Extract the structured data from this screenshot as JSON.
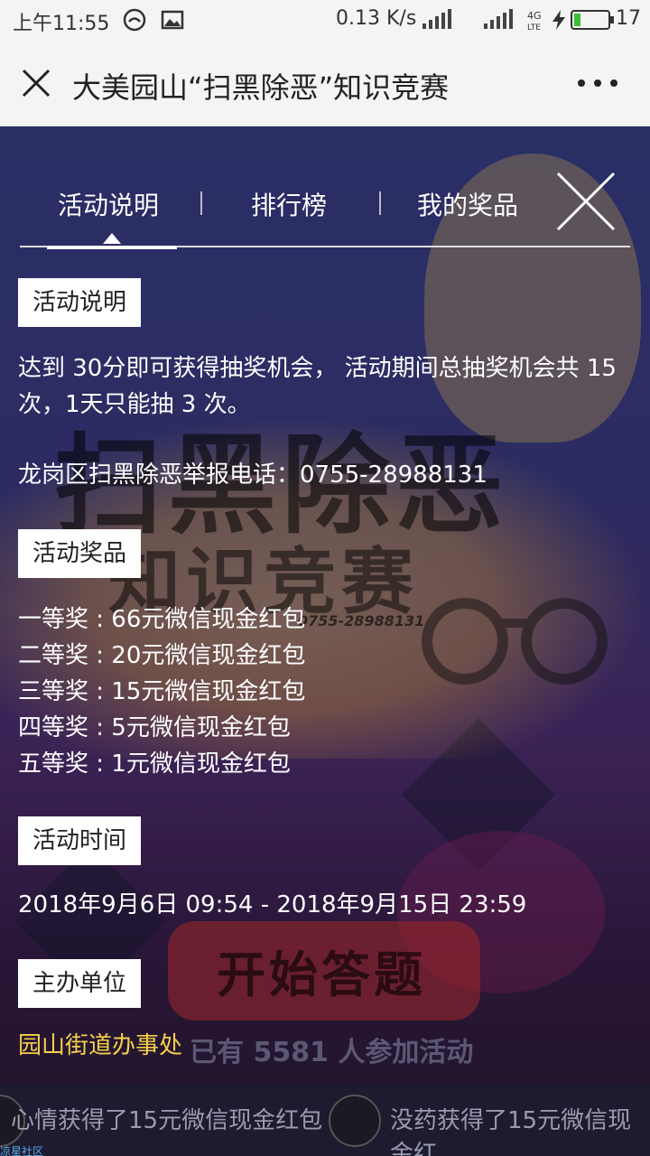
{
  "status_bar": {
    "time": "上午11:55",
    "net_speed": "0.13 K/s",
    "battery": "17",
    "battery_level": 0.17,
    "icons": [
      "wechat-icon",
      "image-icon",
      "signal-icon",
      "signal-icon",
      "4g-lte-icon",
      "charging-icon",
      "battery-icon"
    ]
  },
  "titlebar": {
    "title": "大美园山“扫黑除恶”知识竞赛",
    "close_icon": "close-icon",
    "more_icon": "more-icon"
  },
  "tabs": {
    "items": [
      {
        "label": "活动说明",
        "active": true
      },
      {
        "label": "排行榜",
        "active": false
      },
      {
        "label": "我的奖品",
        "active": false
      }
    ]
  },
  "sections": {
    "rules_title": "活动说明",
    "rules_line1": "达到 30分即可获得抽奖机会， 活动期间总抽奖机会共 15",
    "rules_line2": "次，1天只能抽 3 次。",
    "hotline": "龙岗区扫黑除恶举报电话：0755-28988131",
    "prizes_title": "活动奖品",
    "prizes": [
      "一等奖 : 66元微信现金红包",
      "二等奖 : 20元微信现金红包",
      "三等奖 : 15元微信现金红包",
      "四等奖 : 5元微信现金红包",
      "五等奖 : 1元微信现金红包"
    ],
    "time_title": "活动时间",
    "time_range": "2018年9月6日 09:54 - 2018年9月15日 23:59",
    "organizer_title": "主办单位",
    "organizer": "园山街道办事处"
  },
  "background": {
    "headline": "扫黑除恶",
    "subheadline": "知识竞赛",
    "phone": "0755-28988131",
    "start_button": "开始答题",
    "participants": "已有 5581 人参加活动"
  },
  "ticker": {
    "item1": "心情获得了15元微信现金红包",
    "item2": "没药获得了15元微信现金红"
  },
  "watermark": "凉星社区"
}
